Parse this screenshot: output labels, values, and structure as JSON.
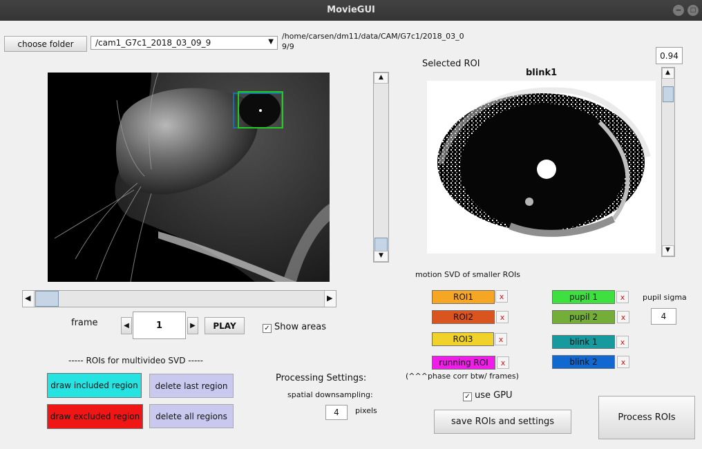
{
  "window": {
    "title": "MovieGUI",
    "controls": [
      "−",
      "□",
      "×"
    ]
  },
  "folder": {
    "choose_label": "choose folder",
    "selected": "/cam1_G7c1_2018_03_09_9",
    "path_line1": "/home/carsen/dm11/data/CAM/G7c1/2018_03_0",
    "path_line2": "9/9"
  },
  "roi_panel": {
    "selected_label": "Selected ROI",
    "roi_title": "blink1",
    "saturation": "0.94"
  },
  "playback": {
    "frame_label": "frame",
    "frame_value": "1",
    "play_label": "PLAY",
    "show_areas_label": "Show areas",
    "show_areas_checked": true
  },
  "multivideo": {
    "header": "----- ROIs for multivideo SVD -----",
    "draw_included": "draw included region",
    "delete_last": "delete last region",
    "draw_excluded": "draw excluded region",
    "delete_all": "delete all regions"
  },
  "processing": {
    "header": "Processing Settings:",
    "downsampling_label": "spatial downsampling:",
    "downsampling_value": "4",
    "pixels_label": "pixels",
    "use_gpu_label": "use GPU",
    "use_gpu_checked": true,
    "save_label": "save ROIs and settings",
    "process_label": "Process ROIs"
  },
  "motion": {
    "header": "motion SVD of smaller ROIs",
    "roi1": "ROI1",
    "roi2": "ROI2",
    "roi3": "ROI3",
    "running": "running ROI",
    "phase_note": "(^^^phase corr btw/ frames)",
    "pupil1": "pupil 1",
    "pupil2": "pupil 2",
    "blink1": "blink 1",
    "blink2": "blink 2",
    "pupil_sigma_label": "pupil sigma",
    "pupil_sigma_value": "4",
    "delete_glyph": "x"
  },
  "colors": {
    "roi1": "#f5a623",
    "roi2": "#d9541e",
    "roi3": "#f0d22a",
    "running": "#ee1ee8",
    "pupil1": "#3ee040",
    "pupil2": "#74ad37",
    "blink1": "#179a9e",
    "blink2": "#1068d0",
    "draw_included": "#25e3e0",
    "draw_excluded": "#f01616",
    "delete_buttons": "#c9c9ef"
  }
}
